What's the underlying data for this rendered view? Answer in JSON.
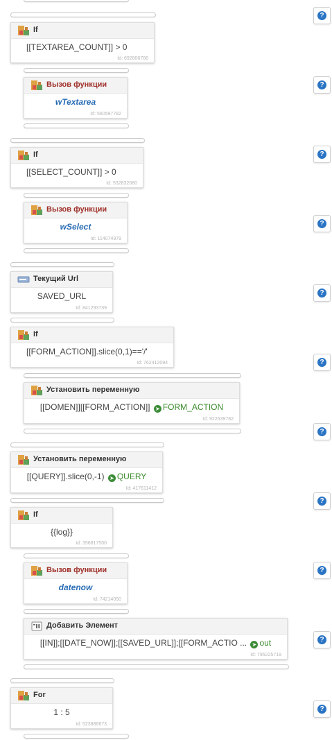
{
  "blocks": [
    {
      "title": "If",
      "kind": "if",
      "body": "[[TEXTAREA_COUNT]] > 0",
      "id_label": "Id: 692806786"
    },
    {
      "title": "Вызов функции",
      "kind": "function",
      "body": "wTextarea",
      "id_label": "Id: 560597782"
    },
    {
      "title": "If",
      "kind": "if",
      "body": "[[SELECT_COUNT]] > 0",
      "id_label": "Id: 532832680"
    },
    {
      "title": "Вызов функции",
      "kind": "function",
      "body": "wSelect",
      "id_label": "Id: 114074979"
    },
    {
      "title": "Текущий Url",
      "kind": "url",
      "body": "SAVED_URL",
      "id_label": "Id: 841293739"
    },
    {
      "title": "If",
      "kind": "if",
      "body": "[[FORM_ACTION]].slice(0,1)=='/'",
      "id_label": "Id: 762412094"
    },
    {
      "title": "Установить переменную",
      "kind": "setvar",
      "body": "[[DOMEN]][[FORM_ACTION]]",
      "target": "FORM_ACTION",
      "id_label": "Id: 922639782"
    },
    {
      "title": "Установить переменную",
      "kind": "setvar",
      "body": "[[QUERY]].slice(0,-1)",
      "target": "QUERY",
      "id_label": "Id: 417611412"
    },
    {
      "title": "If",
      "kind": "if",
      "body": "{{log}}",
      "id_label": "Id: 356817500"
    },
    {
      "title": "Вызов функции",
      "kind": "function",
      "body": "datenow",
      "id_label": "Id: 74214050"
    },
    {
      "title": "Добавить Элемент",
      "kind": "additem",
      "body": "[[IN]];[[DATE_NOW]];[[SAVED_URL]];[[FORM_ACTIO ...",
      "target": "out",
      "id_label": "Id: 795225719"
    },
    {
      "title": "For",
      "kind": "for",
      "body": "1 : 5",
      "id_label": "Id: 523886673"
    }
  ],
  "help_buttons": [
    "?",
    "?",
    "?",
    "?",
    "?",
    "?",
    "?",
    "?",
    "?",
    "?",
    "?"
  ],
  "colors": {
    "function_title": "#a0302a",
    "function_name": "#2a6db5",
    "output_variable": "#3a8a2a",
    "help_icon": "#2a74c4"
  }
}
